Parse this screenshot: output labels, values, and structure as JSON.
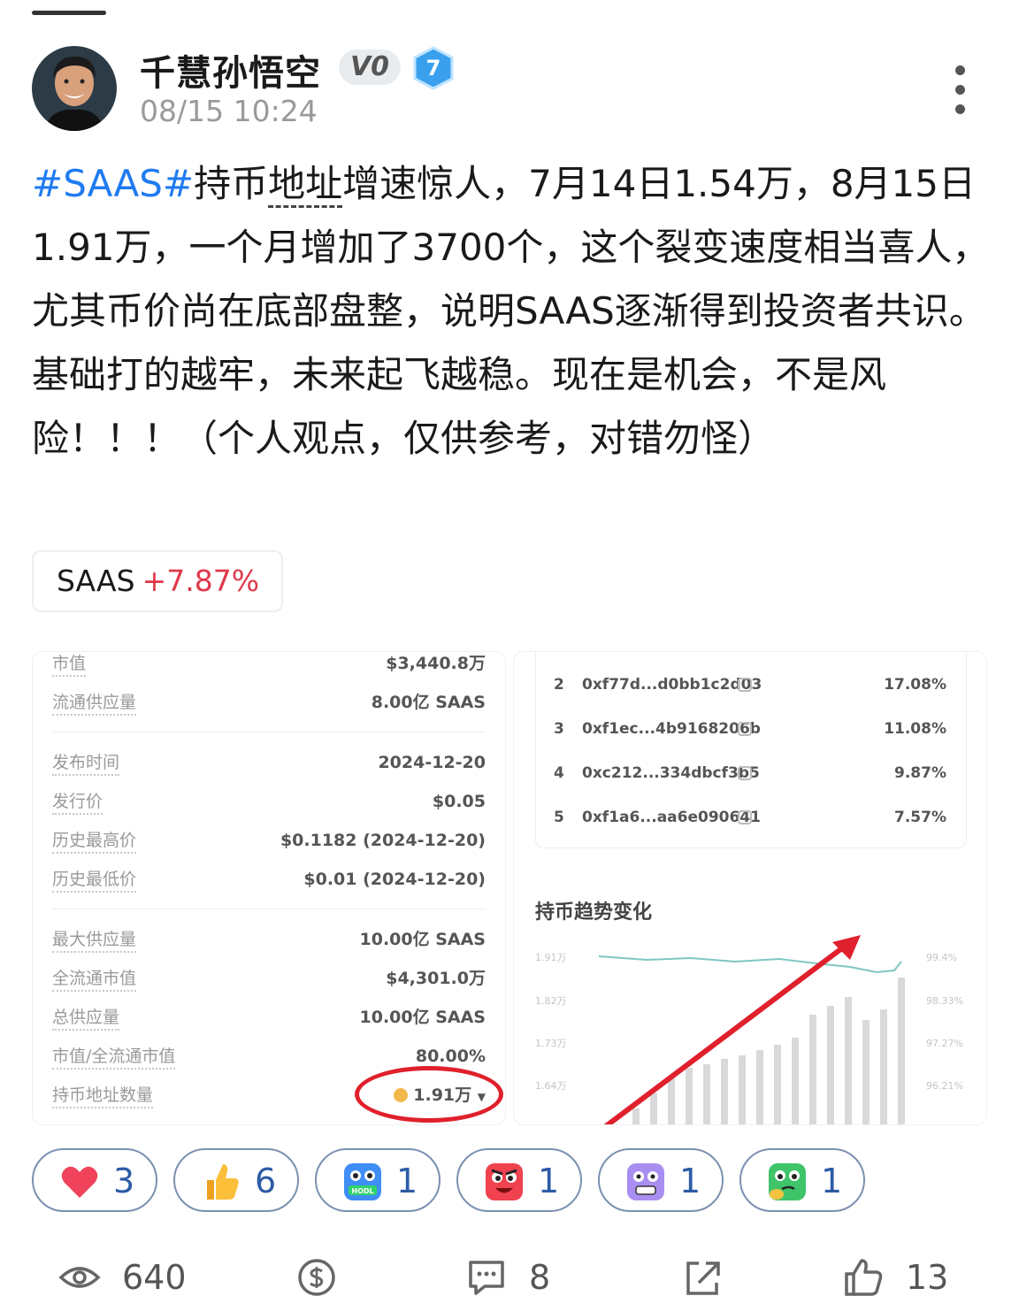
{
  "post": {
    "author": "千慧孙悟空",
    "vip_badge": "V0",
    "level": "7",
    "time": "08/15 10:24",
    "hashtag": "#SAAS#",
    "body_a": "持币",
    "body_b": "地址",
    "body_c": "增速惊人，7月14日1.54万，8月15日1.91万，一个月增加了3700个，这个裂变速度相当喜人，尤其币价尚在底部盘整，说明SAAS逐渐得到投资者共识。基础打的越牢，未来起飞越稳。现在是机会，不是风险！！！（个人观点，仅供参考，对错勿怪）"
  },
  "coin_tag": {
    "symbol": "SAAS",
    "change": "+7.87%",
    "change_color": "#e0384a"
  },
  "token_info": {
    "rows": [
      {
        "key": "市值",
        "value": "$3,440.8万"
      },
      {
        "key": "流通供应量",
        "value": "8.00亿 SAAS"
      },
      {
        "key": "发布时间",
        "value": "2024-12-20"
      },
      {
        "key": "发行价",
        "value": "$0.05"
      },
      {
        "key": "历史最高价",
        "value": "$0.1182 (2024-12-20)"
      },
      {
        "key": "历史最低价",
        "value": "$0.01 (2024-12-20)"
      },
      {
        "key": "最大供应量",
        "value": "10.00亿 SAAS"
      },
      {
        "key": "全流通市值",
        "value": "$4,301.0万"
      },
      {
        "key": "总供应量",
        "value": "10.00亿 SAAS"
      },
      {
        "key": "市值/全流通市值",
        "value": "80.00%"
      },
      {
        "key": "持币地址数量",
        "value": "1.91万"
      }
    ],
    "caret": "▼"
  },
  "holders": [
    {
      "rank": "2",
      "address": "0xf77d...d0bb1c2d03",
      "share": "17.08%"
    },
    {
      "rank": "3",
      "address": "0xf1ec...4b9168206b",
      "share": "11.08%"
    },
    {
      "rank": "4",
      "address": "0xc212...334dbcf3b5",
      "share": "9.87%"
    },
    {
      "rank": "5",
      "address": "0xf1a6...aa6e090641",
      "share": "7.57%"
    }
  ],
  "trend": {
    "title": "持币趋势变化",
    "left_ticks": [
      "1.91万",
      "1.82万",
      "1.73万",
      "1.64万"
    ],
    "right_ticks": [
      "99.4%",
      "98.33%",
      "97.27%",
      "96.21%"
    ]
  },
  "reactions": [
    {
      "emoji": "heart-icon",
      "count": "3"
    },
    {
      "emoji": "thumbs-up-icon",
      "count": "6"
    },
    {
      "emoji": "hodl-emoji-icon",
      "count": "1",
      "label": "HODL"
    },
    {
      "emoji": "angry-emoji-icon",
      "count": "1"
    },
    {
      "emoji": "scared-emoji-icon",
      "count": "1"
    },
    {
      "emoji": "thinking-emoji-icon",
      "count": "1"
    }
  ],
  "footer": {
    "views": "640",
    "comments": "8",
    "likes": "13"
  }
}
